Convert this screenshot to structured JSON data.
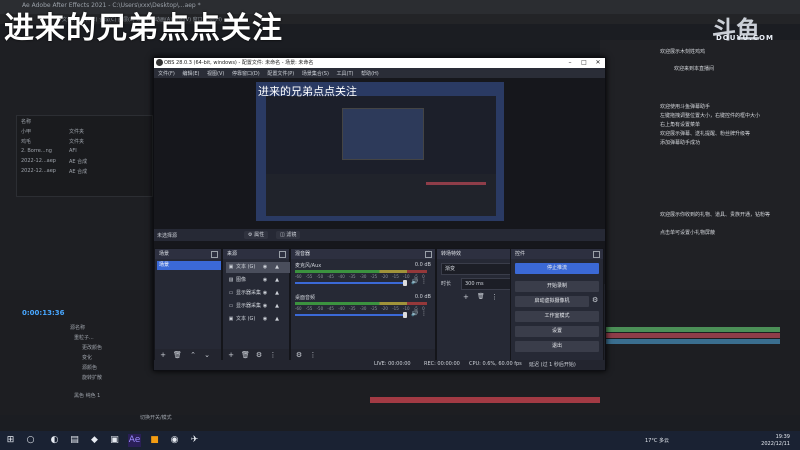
{
  "desktop": {
    "ae_title": "Ae Adobe After Effects 2021 - C:\\Users\\xxx\\Desktop\\...aep *",
    "ae_menu": "文件(F)  编辑(E)  合成(C)  图层(L)  效果(T)  动画(A)  视图(V)  窗口  帮助(H)",
    "project_rows": [
      "名称",
      "小甲",
      "鸡毛",
      "2. Borre...ng",
      "2022-12...aep",
      "2022-12...aep"
    ],
    "project_types": [
      "",
      "文件夹",
      "文件夹",
      "AFI",
      "AE 合成",
      "AE 合成"
    ],
    "timecode": "0:00:13:36",
    "timeline_layer_header": "源名称",
    "timeline_layers": [
      "重粒子...",
      "更改颜色",
      "变化",
      "源颜色",
      "旋转扩散",
      "黑色 纯色 1"
    ],
    "timeline_footer": "切换开关/模式"
  },
  "overlay": {
    "headline": "进来的兄弟点点关注",
    "logo_mark": "斗鱼",
    "logo_text": "DOUYU.COM"
  },
  "side_panel": {
    "lines": [
      "欢迎展示木刻姓鸡鸡",
      "欢迎来到本直播间",
      "欢迎使用斗鱼弹幕助手",
      "左键拖拽调整位置大小，右键控件的框中大小",
      "右上角有设置菜单",
      "欢迎展示弹幕、送礼提醒、粉丝牌升级等",
      "添加弹幕助手成功",
      "欢迎展示你收到的礼物、道具、贵族开通，钻粉等",
      "点击单可设置小礼物屏蔽"
    ]
  },
  "obs": {
    "title": "OBS 28.0.3 (64-bit, windows) - 配置文件: 未命名 - 场景: 未命名",
    "menu": [
      "文件(F)",
      "编辑(E)",
      "视图(V)",
      "停靠窗口(D)",
      "配置文件(P)",
      "场景集合(S)",
      "工具(T)",
      "帮助(H)"
    ],
    "preview_overlay": "进来的兄弟点点关注",
    "no_source": "未选择源",
    "properties_btn": "属性",
    "filters_btn": "滤镜",
    "docks": {
      "scenes": "场景",
      "sources": "来源",
      "mixer": "混音器",
      "transitions": "转场特效",
      "controls": "控件"
    },
    "scene_item": "场景",
    "sources": [
      "文本 (G)",
      "图像",
      "显示器采集",
      "显示器采集",
      "文本 (G)"
    ],
    "mixer": {
      "channels": [
        {
          "name": "麦克风/Aux",
          "db": "0.0 dB"
        },
        {
          "name": "桌面音频",
          "db": "0.0 dB"
        }
      ],
      "scale": "-60 -55 -50 -45 -40 -35 -30 -25 -20 -15 -10 -5 0"
    },
    "transitions": {
      "type": "渐变",
      "duration_label": "时长",
      "duration": "300 ms"
    },
    "controls": {
      "stop_stream": "停止推流",
      "start_record": "开始录制",
      "virtual_cam": "启动虚拟摄像机",
      "studio_mode": "工作室模式",
      "settings": "设置",
      "exit": "退出"
    },
    "status": {
      "live": "LIVE: 00:00:00",
      "rec": "REC: 00:00:00",
      "cpu": "CPU: 0.6%, 60.00 fps",
      "net": "延迟 (过 1 秒后开始)"
    }
  },
  "taskbar": {
    "weather": "17°C 多云",
    "time": "19:39",
    "date": "2022/12/11"
  }
}
